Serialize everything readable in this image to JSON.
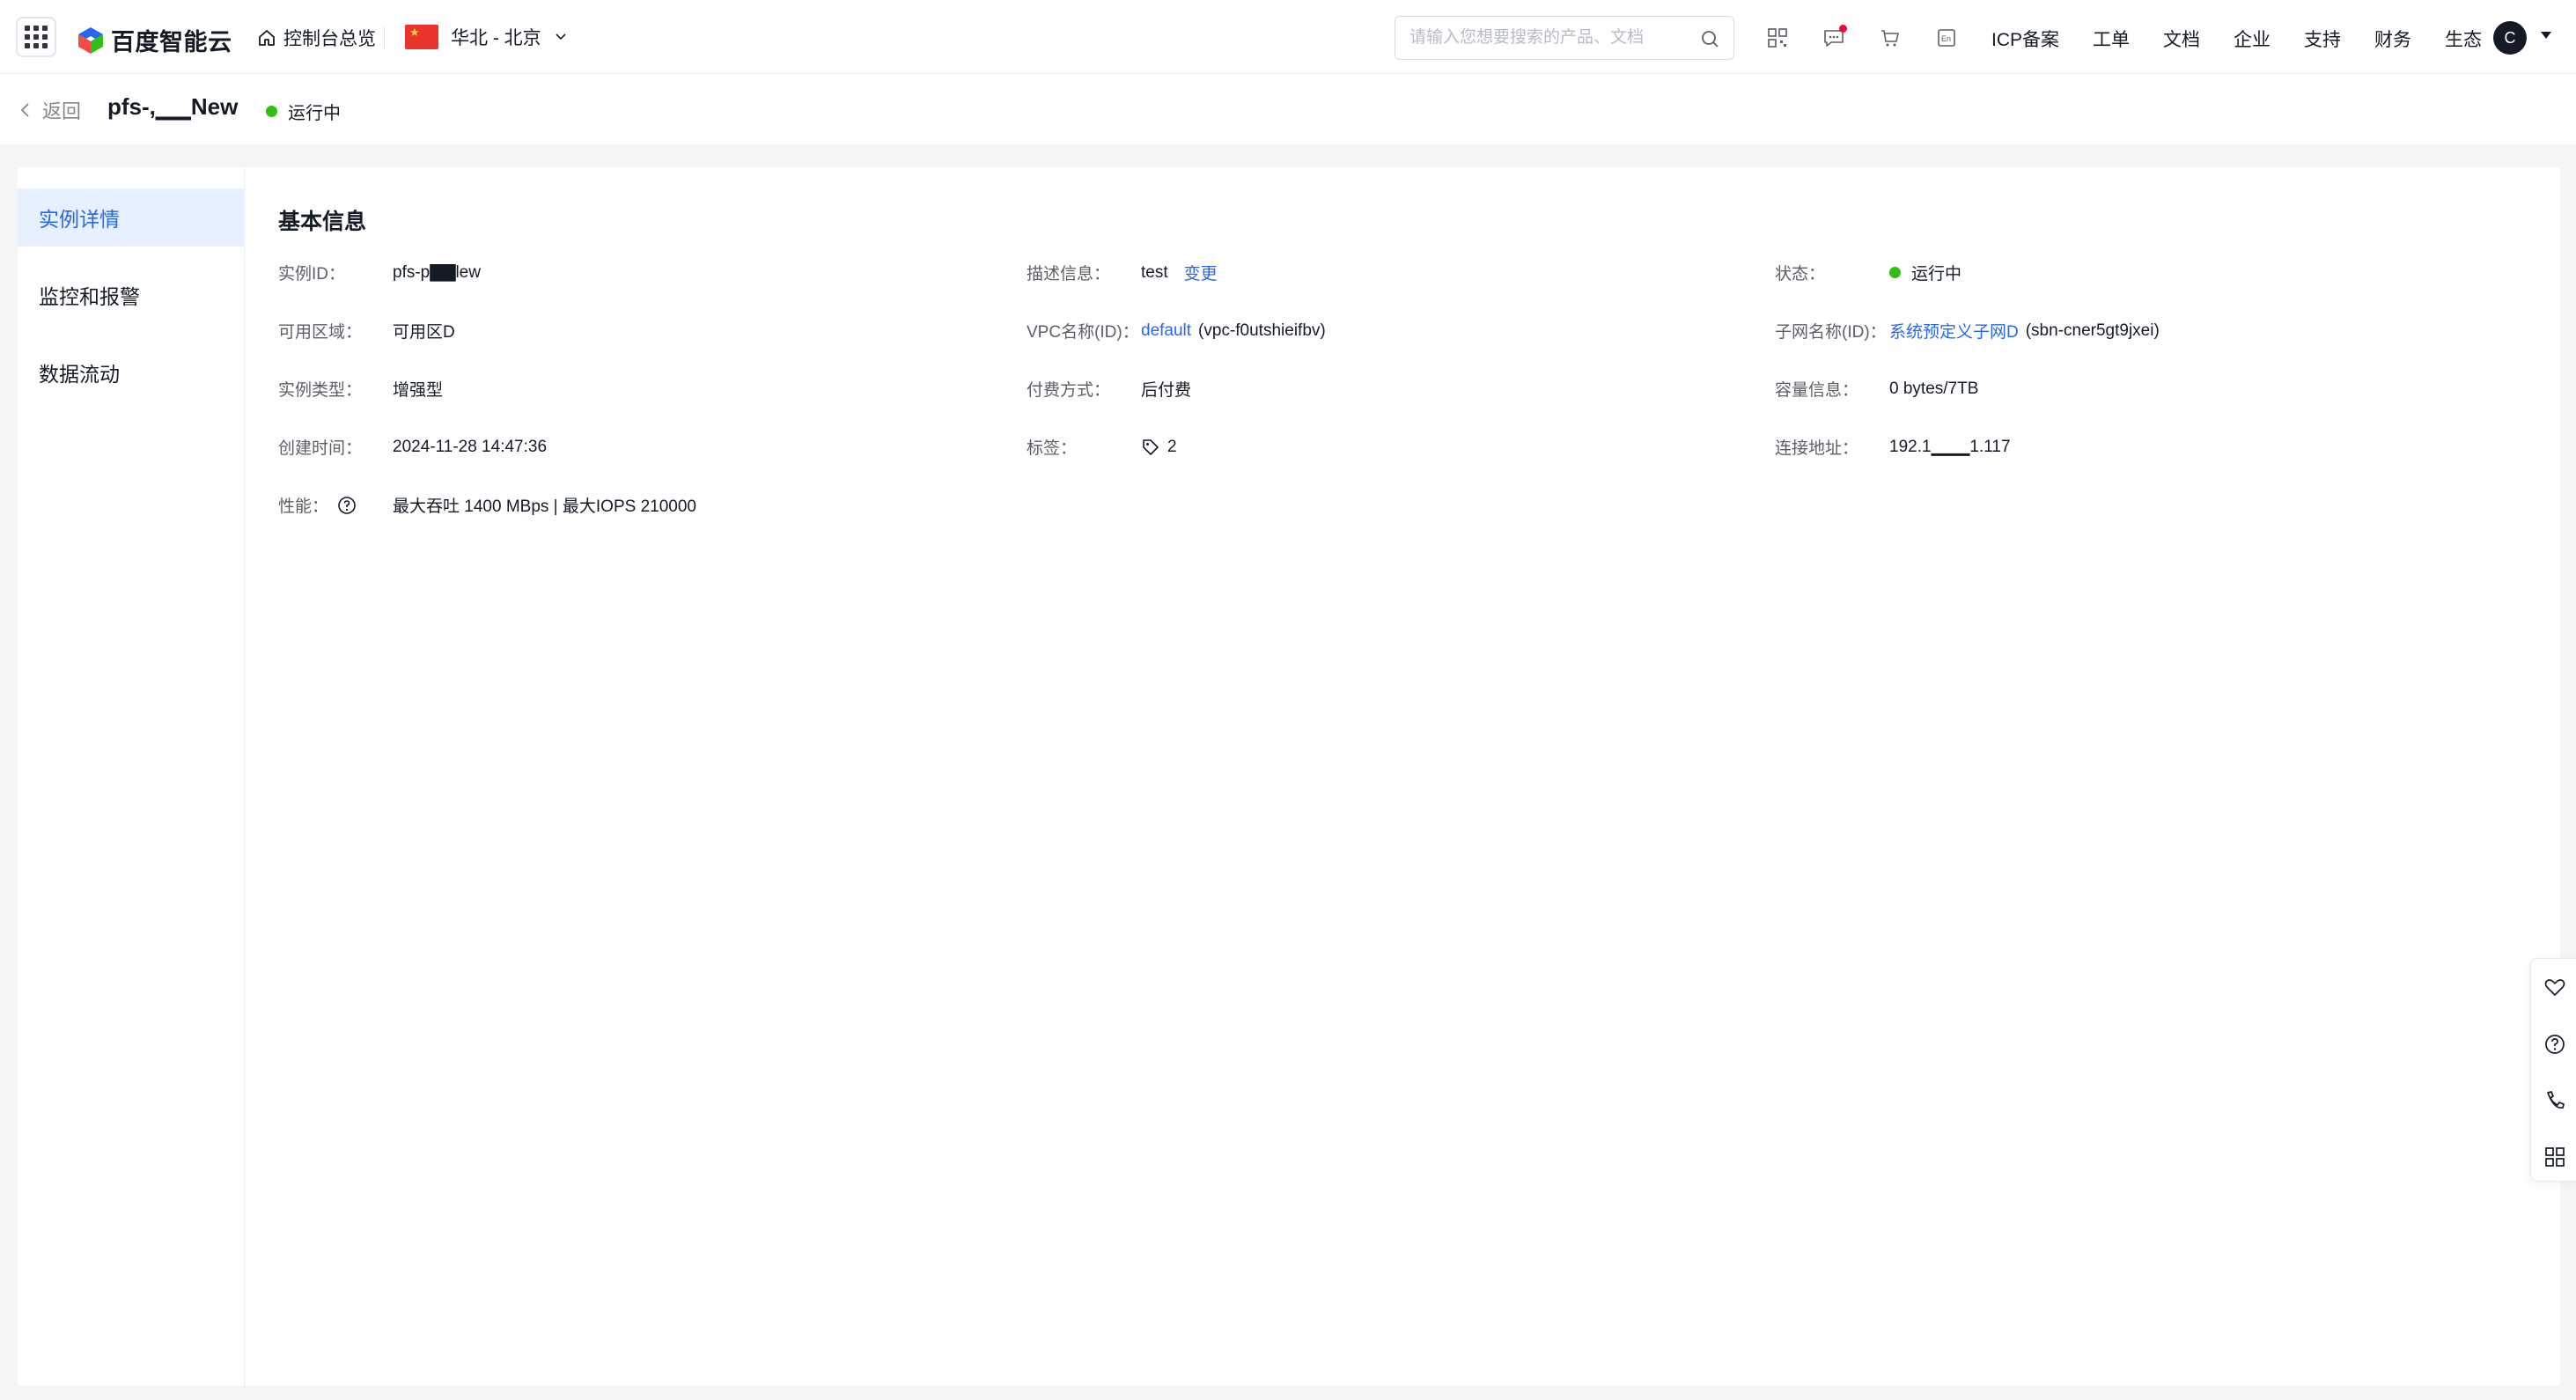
{
  "topbar": {
    "logo_text": "百度智能云",
    "home_label": "控制台总览",
    "region_label": "华北 - 北京",
    "search_placeholder": "请输入您想要搜索的产品、文档",
    "links": [
      "ICP备案",
      "工单",
      "文档",
      "企业",
      "支持",
      "财务",
      "生态"
    ],
    "avatar_letter": "C",
    "icons": [
      "qrcode-icon",
      "message-icon",
      "cart-icon",
      "language-icon"
    ]
  },
  "subheader": {
    "back_label": "返回",
    "instance_title": "pfs-,▁▁New",
    "status_label": "运行中"
  },
  "sidemenu": {
    "items": [
      {
        "label": "实例详情",
        "active": true
      },
      {
        "label": "监控和报警",
        "active": false
      },
      {
        "label": "数据流动",
        "active": false
      }
    ]
  },
  "basic_info": {
    "title": "基本信息",
    "instance_id": {
      "label": "实例ID：",
      "value": "pfs-p▇▇lew"
    },
    "zone": {
      "label": "可用区域：",
      "value": "可用区D"
    },
    "type": {
      "label": "实例类型：",
      "value": "增强型"
    },
    "created": {
      "label": "创建时间：",
      "value": "2024-11-28 14:47:36"
    },
    "performance": {
      "label": "性能：",
      "value": "最大吞吐 1400 MBps | 最大IOPS 210000"
    },
    "description": {
      "label": "描述信息：",
      "value": "test",
      "action": "变更"
    },
    "vpc": {
      "label": "VPC名称(ID)：",
      "link": "default",
      "value": "(vpc-f0utshieifbv)"
    },
    "billing": {
      "label": "付费方式：",
      "value": "后付费"
    },
    "tags": {
      "label": "标签：",
      "value": "2"
    },
    "status": {
      "label": "状态：",
      "value": "运行中"
    },
    "subnet": {
      "label": "子网名称(ID)：",
      "link": "系统预定义子网D",
      "value": "(sbn-cner5gt9jxei)"
    },
    "capacity": {
      "label": "容量信息：",
      "value": "0 bytes/7TB"
    },
    "address": {
      "label": "连接地址：",
      "value": "192.1▁▁▁1.117"
    }
  },
  "colors": {
    "accent": "#2468f2",
    "status_green": "#30bf13",
    "active_bg": "#e6f0ff",
    "page_bg": "#f4f5f7"
  },
  "floatbar": {
    "icons": [
      "heart-icon",
      "question-icon",
      "phone-icon",
      "apps-icon"
    ]
  }
}
